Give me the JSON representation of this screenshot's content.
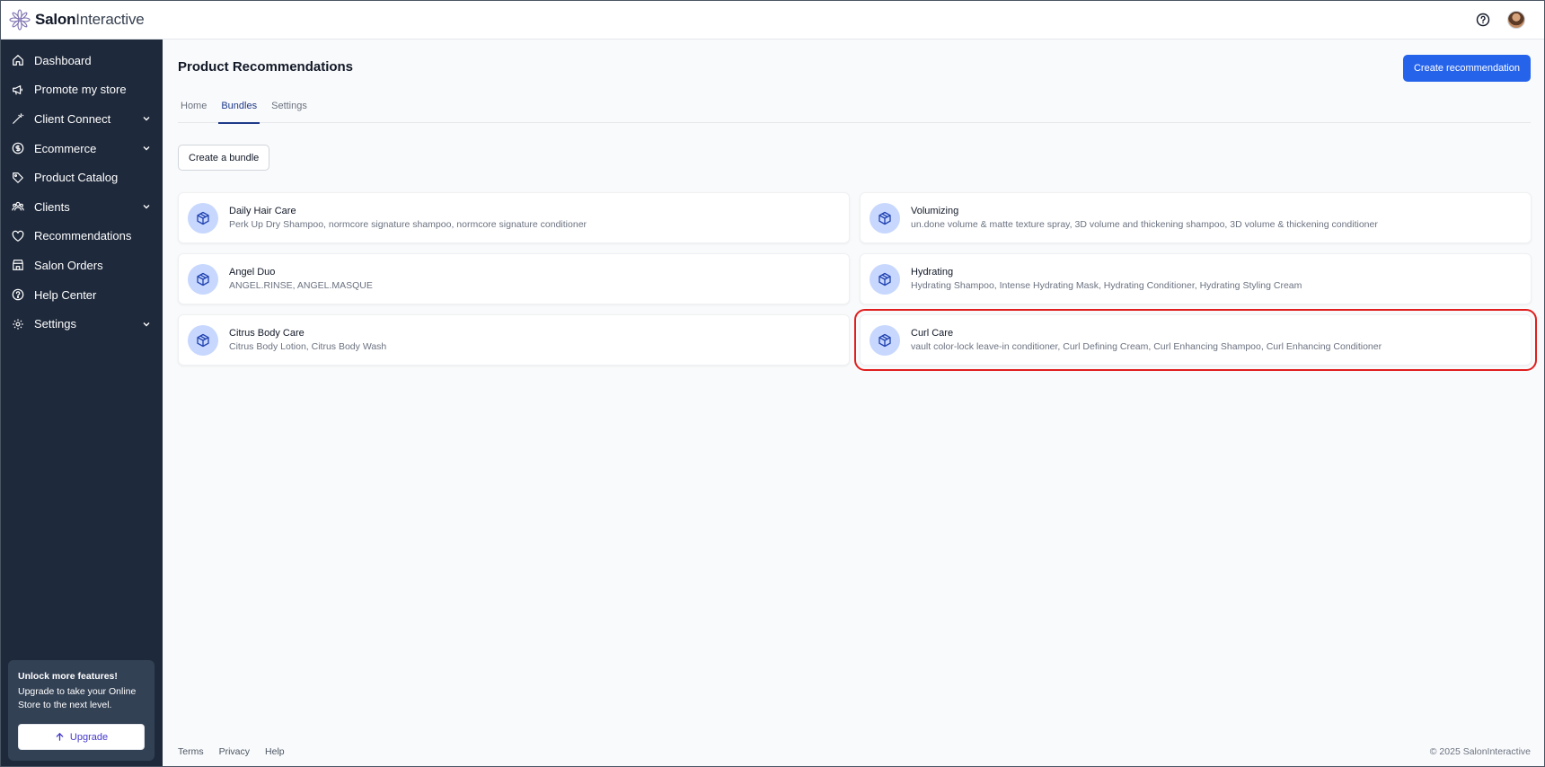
{
  "brand": {
    "name_bold": "Salon",
    "name_light": "Interactive"
  },
  "topbar": {
    "help_icon": "help-circle-icon",
    "avatar": "user-avatar"
  },
  "sidebar": {
    "items": [
      {
        "label": "Dashboard",
        "icon": "home-icon",
        "has_chevron": false
      },
      {
        "label": "Promote my store",
        "icon": "megaphone-icon",
        "has_chevron": false
      },
      {
        "label": "Client Connect",
        "icon": "wand-icon",
        "has_chevron": true
      },
      {
        "label": "Ecommerce",
        "icon": "dollar-circle-icon",
        "has_chevron": true
      },
      {
        "label": "Product Catalog",
        "icon": "tag-icon",
        "has_chevron": false
      },
      {
        "label": "Clients",
        "icon": "users-icon",
        "has_chevron": true
      },
      {
        "label": "Recommendations",
        "icon": "heart-icon",
        "has_chevron": false
      },
      {
        "label": "Salon Orders",
        "icon": "store-icon",
        "has_chevron": false
      },
      {
        "label": "Help Center",
        "icon": "help-circle-icon",
        "has_chevron": false
      },
      {
        "label": "Settings",
        "icon": "gear-icon",
        "has_chevron": true
      }
    ],
    "upgrade": {
      "title": "Unlock more features!",
      "description": "Upgrade to take your Online Store to the next level.",
      "button_label": "Upgrade"
    }
  },
  "main": {
    "title": "Product Recommendations",
    "primary_action": "Create recommendation",
    "tabs": [
      {
        "label": "Home",
        "active": false
      },
      {
        "label": "Bundles",
        "active": true
      },
      {
        "label": "Settings",
        "active": false
      }
    ],
    "create_bundle_label": "Create a bundle",
    "bundles": [
      {
        "name": "Daily Hair Care",
        "products": "Perk Up Dry Shampoo, normcore signature shampoo, normcore signature conditioner"
      },
      {
        "name": "Volumizing",
        "products": "un.done volume & matte texture spray, 3D volume and thickening shampoo, 3D volume & thickening conditioner"
      },
      {
        "name": "Angel Duo",
        "products": "ANGEL.RINSE, ANGEL.MASQUE"
      },
      {
        "name": "Hydrating",
        "products": "Hydrating Shampoo, Intense Hydrating Mask, Hydrating Conditioner, Hydrating Styling Cream"
      },
      {
        "name": "Citrus Body Care",
        "products": "Citrus Body Lotion, Citrus Body Wash"
      },
      {
        "name": "Curl Care",
        "products": "vault color-lock leave-in conditioner, Curl Defining Cream, Curl Enhancing Shampoo, Curl Enhancing Conditioner",
        "highlighted": true
      }
    ]
  },
  "footer": {
    "links": [
      "Terms",
      "Privacy",
      "Help"
    ],
    "copyright": "© 2025 SalonInteractive"
  },
  "colors": {
    "sidebar_bg": "#1e293b",
    "primary": "#2563eb",
    "badge_bg": "#c7d7fe",
    "highlight": "#e11d1d"
  }
}
